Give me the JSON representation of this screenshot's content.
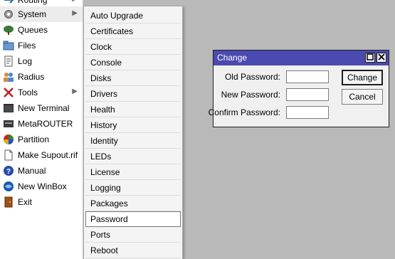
{
  "sidebar": {
    "items": [
      {
        "label": "Routing",
        "icon": "routing-icon",
        "has_submenu": true
      },
      {
        "label": "System",
        "icon": "gear-icon",
        "has_submenu": true,
        "selected": true
      },
      {
        "label": "Queues",
        "icon": "queues-icon",
        "has_submenu": false
      },
      {
        "label": "Files",
        "icon": "folder-icon",
        "has_submenu": false
      },
      {
        "label": "Log",
        "icon": "log-icon",
        "has_submenu": false
      },
      {
        "label": "Radius",
        "icon": "users-icon",
        "has_submenu": false
      },
      {
        "label": "Tools",
        "icon": "tools-icon",
        "has_submenu": true
      },
      {
        "label": "New Terminal",
        "icon": "terminal-icon",
        "has_submenu": false
      },
      {
        "label": "MetaROUTER",
        "icon": "metarouter-icon",
        "has_submenu": false
      },
      {
        "label": "Partition",
        "icon": "partition-icon",
        "has_submenu": false
      },
      {
        "label": "Make Supout.rif",
        "icon": "document-icon",
        "has_submenu": false
      },
      {
        "label": "Manual",
        "icon": "help-icon",
        "has_submenu": false
      },
      {
        "label": "New WinBox",
        "icon": "winbox-icon",
        "has_submenu": false
      },
      {
        "label": "Exit",
        "icon": "exit-icon",
        "has_submenu": false
      }
    ]
  },
  "submenu": {
    "items": [
      {
        "label": "Auto Upgrade"
      },
      {
        "label": "Certificates"
      },
      {
        "label": "Clock"
      },
      {
        "label": "Console"
      },
      {
        "label": "Disks"
      },
      {
        "label": "Drivers"
      },
      {
        "label": "Health"
      },
      {
        "label": "History"
      },
      {
        "label": "Identity"
      },
      {
        "label": "LEDs"
      },
      {
        "label": "License"
      },
      {
        "label": "Logging"
      },
      {
        "label": "Packages"
      },
      {
        "label": "Password",
        "hovered": true
      },
      {
        "label": "Ports"
      },
      {
        "label": "Reboot"
      }
    ]
  },
  "dialog": {
    "title": "Change",
    "fields": [
      {
        "label": "Old Password:",
        "value": ""
      },
      {
        "label": "New Password:",
        "value": ""
      },
      {
        "label": "Confirm Password:",
        "value": ""
      }
    ],
    "change_label": "Change",
    "cancel_label": "Cancel"
  },
  "colors": {
    "desktop_bg": "#b9b9b9",
    "titlebar_bg": "#4a4ab0",
    "menu_bg": "#f4f4f4"
  }
}
